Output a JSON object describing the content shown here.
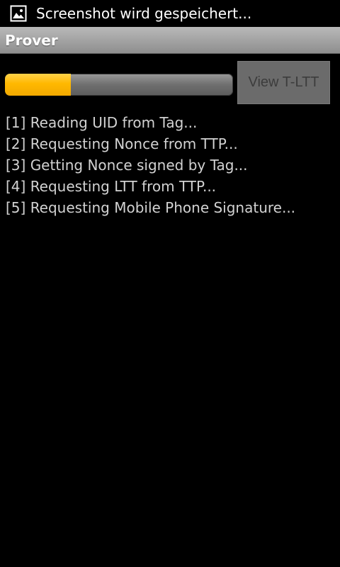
{
  "status_bar": {
    "icon": "image-icon",
    "notification_text": "Screenshot wird gespeichert..."
  },
  "app": {
    "title": "Prover"
  },
  "progress": {
    "fraction": 0.29,
    "fill_color": "#ffb800"
  },
  "actions": {
    "view_button_label": "View T-LTT",
    "view_button_enabled": false
  },
  "log": {
    "lines": [
      "[1] Reading UID from Tag...",
      "[2] Requesting Nonce from TTP...",
      "[3] Getting Nonce signed by Tag...",
      "[4] Requesting LTT from TTP...",
      "[5] Requesting Mobile Phone Signature..."
    ]
  }
}
